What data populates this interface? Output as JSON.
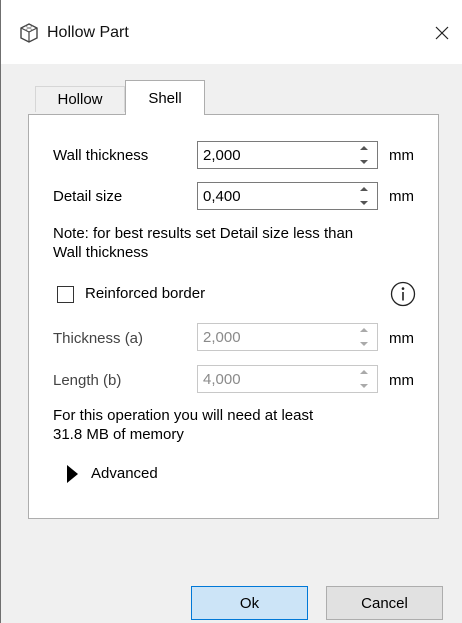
{
  "window": {
    "title": "Hollow Part",
    "icon": "cube-outline-icon",
    "close_label": "✕"
  },
  "tabs": [
    {
      "label": "Hollow",
      "active": false
    },
    {
      "label": "Shell",
      "active": true
    }
  ],
  "fields": {
    "wall_thickness": {
      "label": "Wall thickness",
      "value": "2,000",
      "unit": "mm"
    },
    "detail_size": {
      "label": "Detail size",
      "value": "0,400",
      "unit": "mm"
    },
    "thickness_a": {
      "label": "Thickness (a)",
      "value": "2,000",
      "unit": "mm",
      "disabled": true
    },
    "length_b": {
      "label": "Length (b)",
      "value": "4,000",
      "unit": "mm",
      "disabled": true
    }
  },
  "note": {
    "line1": "Note: for best results set Detail size less than",
    "line2": "Wall thickness"
  },
  "reinforced_border": {
    "label": "Reinforced border",
    "checked": false,
    "info_icon": "info-icon"
  },
  "memory": {
    "line1": "For this operation you will need at least",
    "line2": "31.8 MB of memory"
  },
  "advanced": {
    "label": "Advanced",
    "expanded": false
  },
  "buttons": {
    "ok": "Ok",
    "cancel": "Cancel"
  },
  "colors": {
    "ok_bg": "#cce4f7",
    "ok_border": "#0078d7",
    "dialog_bg": "#f0f0f0"
  }
}
